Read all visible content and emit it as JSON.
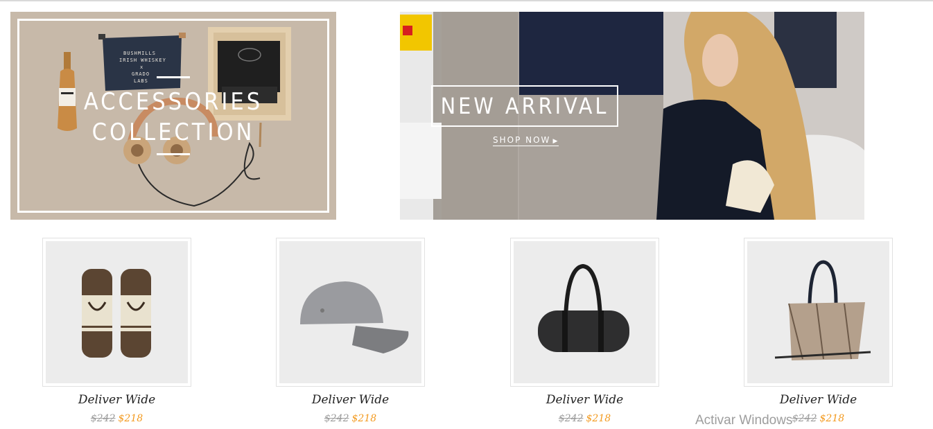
{
  "banners": {
    "accessories": {
      "line1": "ACCESSORIES",
      "line2": "COLLECTION",
      "pouch_text": [
        "BUSHMILLS",
        "IRISH WHISKEY",
        "x",
        "GRADO",
        "LABS"
      ]
    },
    "new_arrival": {
      "title": "NEW ARRIVAL",
      "cta": "SHOP NOW"
    }
  },
  "products": [
    {
      "name": "Deliver Wide",
      "old_price": "$242",
      "price": "$218",
      "image": "mittens-icon"
    },
    {
      "name": "Deliver Wide",
      "old_price": "$242",
      "price": "$218",
      "image": "cap-icon"
    },
    {
      "name": "Deliver Wide",
      "old_price": "$242",
      "price": "$218",
      "image": "duffel-bag-icon"
    },
    {
      "name": "Deliver Wide",
      "old_price": "$242",
      "price": "$218",
      "image": "handbag-icon"
    }
  ],
  "watermark": "Activar Windows",
  "colors": {
    "sale_price": "#f39a1f",
    "old_price": "#9b9b9b",
    "banner_text": "#ffffff"
  }
}
